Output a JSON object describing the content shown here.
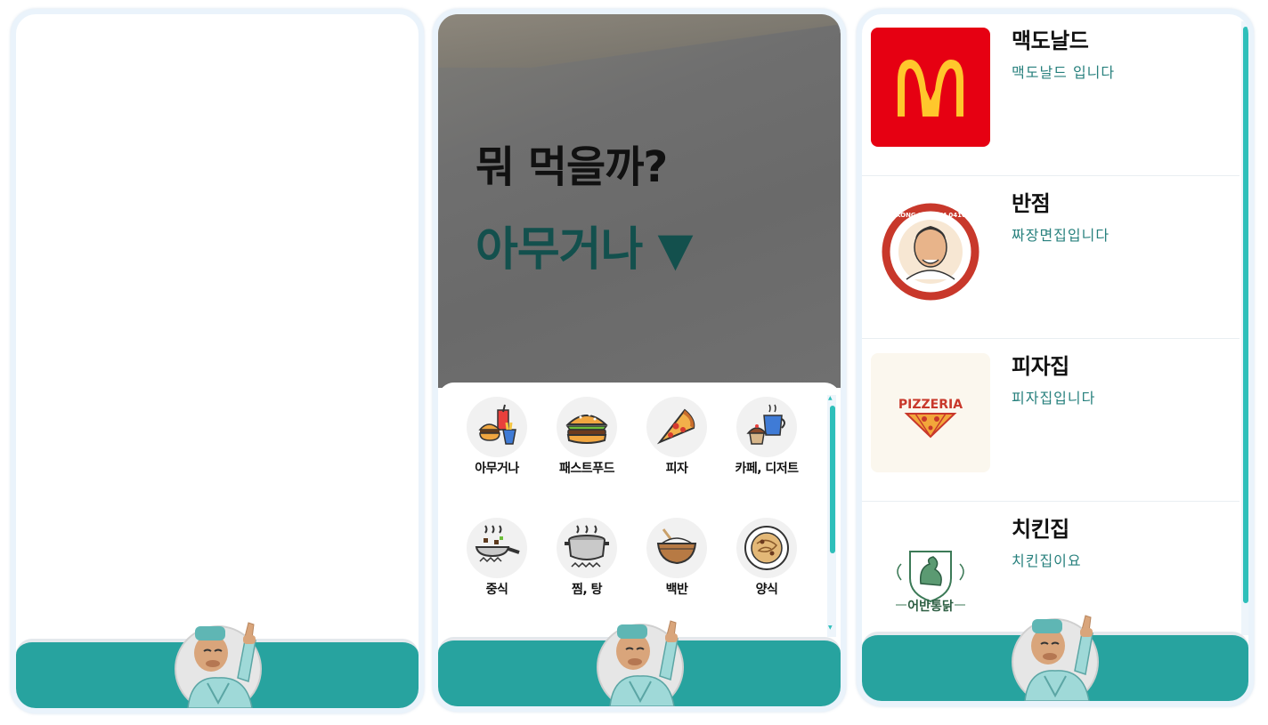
{
  "hero": {
    "title": "뭐 먹을까?",
    "selected": "아무거나 ▼"
  },
  "categories": [
    {
      "label": "아무거나",
      "icon": "combo-meal-icon"
    },
    {
      "label": "패스트푸드",
      "icon": "burger-icon"
    },
    {
      "label": "피자",
      "icon": "pizza-icon"
    },
    {
      "label": "카페, 디저트",
      "icon": "cafe-dessert-icon"
    },
    {
      "label": "중식",
      "icon": "wok-icon"
    },
    {
      "label": "찜, 탕",
      "icon": "pot-icon"
    },
    {
      "label": "백반",
      "icon": "rice-bowl-icon"
    },
    {
      "label": "양식",
      "icon": "pasta-plate-icon"
    }
  ],
  "restaurants": [
    {
      "name": "맥도날드",
      "description": "맥도날드 입니다",
      "logo_text": "",
      "brand_color": "#e60012"
    },
    {
      "name": "반점",
      "description": "짜장면집입니다",
      "logo_text": "HONGKONG BANJUM 0410 PLUS",
      "brand_color": "#c8382b"
    },
    {
      "name": "피자집",
      "description": "피자집입니다",
      "logo_text": "PIZZERIA",
      "brand_color": "#c8382b"
    },
    {
      "name": "치킨집",
      "description": "치킨집이요",
      "logo_text": "어반통닭",
      "brand_color": "#3c7a57"
    }
  ],
  "colors": {
    "accent": "#27a39f",
    "scrollbar": "#2ebfba",
    "title_dark": "#13504d",
    "desc_text": "#27807d"
  }
}
